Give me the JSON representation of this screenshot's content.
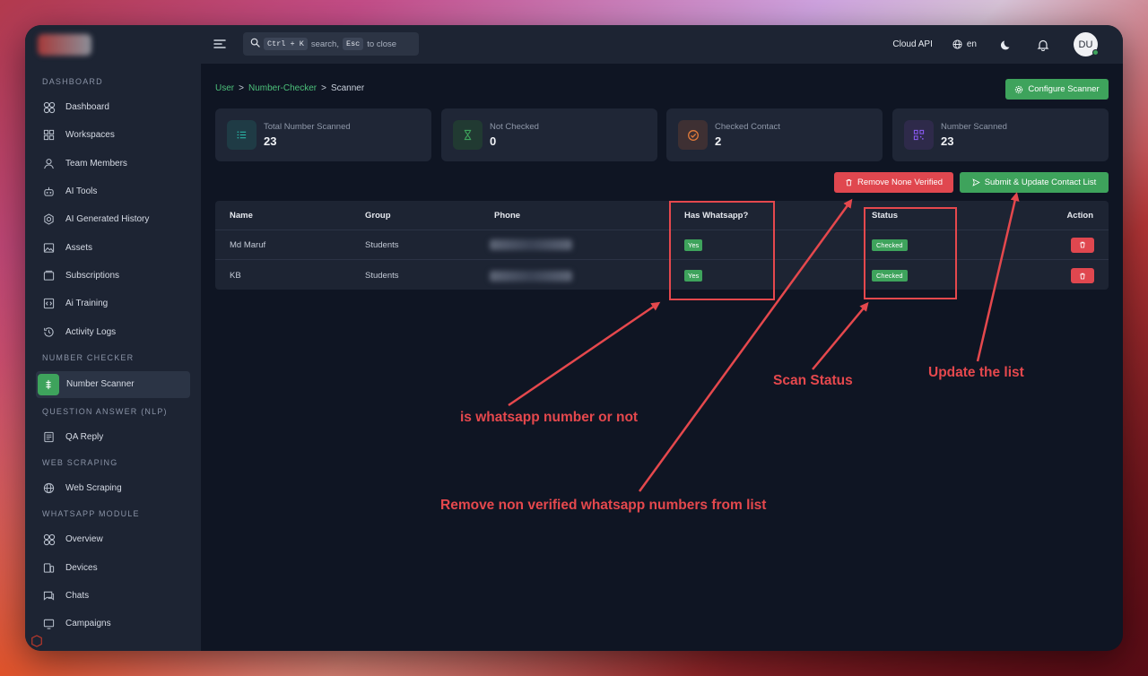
{
  "sidebar": {
    "sections": [
      {
        "title": "DASHBOARD",
        "items": [
          {
            "label": "Dashboard",
            "icon": "dashboard-icon"
          },
          {
            "label": "Workspaces",
            "icon": "grid-icon"
          },
          {
            "label": "Team Members",
            "icon": "user-icon"
          },
          {
            "label": "AI Tools",
            "icon": "robot-icon"
          },
          {
            "label": "AI Generated History",
            "icon": "openai-icon"
          },
          {
            "label": "Assets",
            "icon": "image-icon"
          },
          {
            "label": "Subscriptions",
            "icon": "subscriptions-icon"
          },
          {
            "label": "Ai Training",
            "icon": "code-icon"
          },
          {
            "label": "Activity Logs",
            "icon": "history-icon"
          }
        ]
      },
      {
        "title": "NUMBER CHECKER",
        "items": [
          {
            "label": "Number Scanner",
            "icon": "scanner-icon",
            "active": true
          }
        ]
      },
      {
        "title": "QUESTION ANSWER (NLP)",
        "items": [
          {
            "label": "QA Reply",
            "icon": "document-icon"
          }
        ]
      },
      {
        "title": "WEB SCRAPING",
        "items": [
          {
            "label": "Web Scraping",
            "icon": "globe-icon"
          }
        ]
      },
      {
        "title": "WHATSAPP MODULE",
        "items": [
          {
            "label": "Overview",
            "icon": "dashboard-icon"
          },
          {
            "label": "Devices",
            "icon": "devices-icon"
          },
          {
            "label": "Chats",
            "icon": "chat-icon"
          },
          {
            "label": "Campaigns",
            "icon": "campaign-icon"
          }
        ]
      }
    ]
  },
  "topbar": {
    "search_kbd1": "Ctrl + K",
    "search_text1": "search,",
    "search_kbd2": "Esc",
    "search_text2": "to close",
    "cloud_api": "Cloud API",
    "lang": "en",
    "avatar": "DU"
  },
  "breadcrumb": {
    "user": "User",
    "checker": "Number-Checker",
    "current": "Scanner",
    "sep": ">"
  },
  "buttons": {
    "configure": "Configure Scanner",
    "remove_none": "Remove None Verified",
    "submit": "Submit & Update Contact List"
  },
  "stats": [
    {
      "label": "Total Number Scanned",
      "value": "23",
      "icon": "list-icon",
      "color": "#2bc2b0",
      "bg": "#1f3b45"
    },
    {
      "label": "Not Checked",
      "value": "0",
      "icon": "hourglass-icon",
      "color": "#3ea35c",
      "bg": "#213a32"
    },
    {
      "label": "Checked Contact",
      "value": "2",
      "icon": "check-circle-icon",
      "color": "#e27b3a",
      "bg": "#3e3033"
    },
    {
      "label": "Number Scanned",
      "value": "23",
      "icon": "qr-icon",
      "color": "#8b5cf6",
      "bg": "#2e2a4a"
    }
  ],
  "table": {
    "headers": {
      "name": "Name",
      "group": "Group",
      "phone": "Phone",
      "whatsapp": "Has Whatsapp?",
      "status": "Status",
      "action": "Action"
    },
    "rows": [
      {
        "name": "Md Maruf",
        "group": "Students",
        "whatsapp": "Yes",
        "status": "Checked"
      },
      {
        "name": "KB",
        "group": "Students",
        "whatsapp": "Yes",
        "status": "Checked"
      }
    ]
  },
  "annotations": {
    "whatsapp": "is whatsapp number or not",
    "remove": "Remove non verified whatsapp numbers from list",
    "status": "Scan Status",
    "update": "Update the list",
    "color": "#e5484d"
  }
}
